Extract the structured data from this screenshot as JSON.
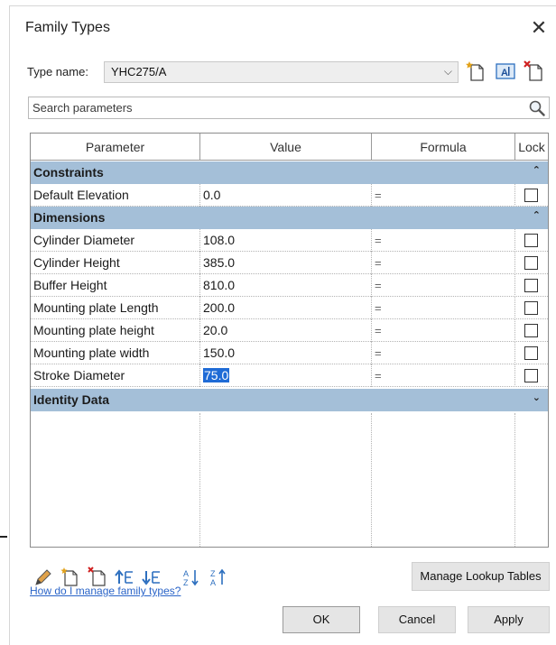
{
  "dialog": {
    "title": "Family Types",
    "close_symbol": "✕"
  },
  "type": {
    "label": "Type name:",
    "value": "YHC275/A",
    "chevron": "⌵",
    "icons": [
      "new-type-icon",
      "rename-type-icon",
      "delete-type-icon"
    ]
  },
  "search": {
    "placeholder": "Search parameters",
    "value": ""
  },
  "table": {
    "headers": {
      "parameter": "Parameter",
      "value": "Value",
      "formula": "Formula",
      "lock": "Lock"
    },
    "groups": [
      {
        "label": "Constraints",
        "toggle": "⌃",
        "rows": [
          {
            "parameter": "Default Elevation",
            "value": "0.0",
            "formula": "=",
            "locked": false
          }
        ]
      },
      {
        "label": "Dimensions",
        "toggle": "⌃",
        "rows": [
          {
            "parameter": "Cylinder Diameter",
            "value": "108.0",
            "formula": "=",
            "locked": false
          },
          {
            "parameter": "Cylinder Height",
            "value": "385.0",
            "formula": "=",
            "locked": false
          },
          {
            "parameter": "Buffer Height",
            "value": "810.0",
            "formula": "=",
            "locked": false
          },
          {
            "parameter": "Mounting plate Length",
            "value": "200.0",
            "formula": "=",
            "locked": false
          },
          {
            "parameter": "Mounting plate height",
            "value": "20.0",
            "formula": "=",
            "locked": false
          },
          {
            "parameter": "Mounting plate width",
            "value": "150.0",
            "formula": "=",
            "locked": false
          },
          {
            "parameter": "Stroke Diameter",
            "value": "75.0",
            "formula": "=",
            "locked": false,
            "selected": true
          }
        ]
      },
      {
        "label": "Identity Data",
        "toggle": "⌄",
        "rows": []
      }
    ]
  },
  "toolbar": {
    "icons": [
      "edit-parameter-icon",
      "new-parameter-icon",
      "delete-parameter-icon",
      "move-up-icon",
      "move-down-icon",
      "sort-ascending-icon",
      "sort-descending-icon"
    ]
  },
  "buttons": {
    "manage_lookup": "Manage Lookup Tables",
    "ok": "OK",
    "cancel": "Cancel",
    "apply": "Apply"
  },
  "help_link": "How do I manage family types?",
  "colors": {
    "group_header": "#a4bfd8",
    "selection": "#1f6bd6",
    "link": "#2a64c8"
  }
}
